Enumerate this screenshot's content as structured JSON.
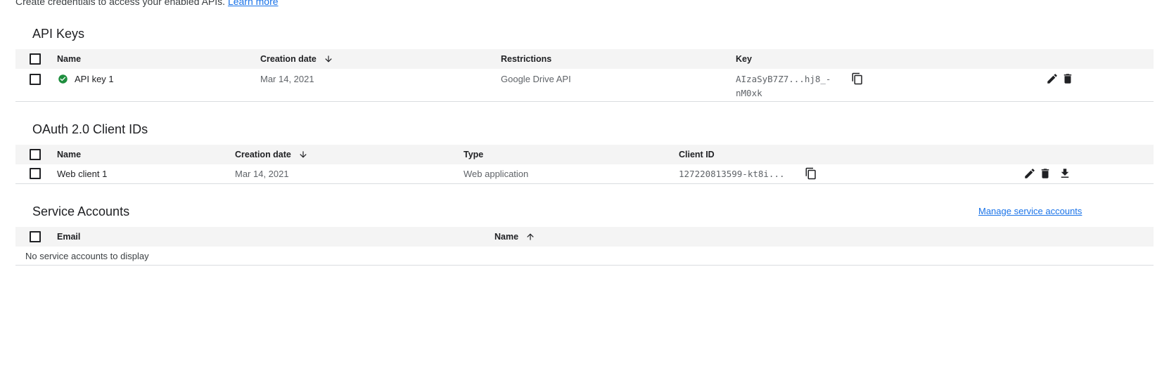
{
  "intro": {
    "text": "Create credentials to access your enabled APIs.",
    "learn_more": "Learn more"
  },
  "api_keys": {
    "title": "API Keys",
    "columns": {
      "name": "Name",
      "creation_date": "Creation date",
      "restrictions": "Restrictions",
      "key": "Key"
    },
    "rows": [
      {
        "name": "API key 1",
        "creation_date": "Mar 14, 2021",
        "restrictions": "Google Drive API",
        "key_line1": "AIzaSyB7Z7...hj8_-",
        "key_line2": "nM0xk"
      }
    ]
  },
  "oauth": {
    "title": "OAuth 2.0 Client IDs",
    "columns": {
      "name": "Name",
      "creation_date": "Creation date",
      "type": "Type",
      "client_id": "Client ID"
    },
    "rows": [
      {
        "name": "Web client 1",
        "creation_date": "Mar 14, 2021",
        "type": "Web application",
        "client_id": "127220813599-kt8i..."
      }
    ]
  },
  "service_accounts": {
    "title": "Service Accounts",
    "manage_link": "Manage service accounts",
    "columns": {
      "email": "Email",
      "name": "Name"
    },
    "empty_text": "No service accounts to display"
  },
  "colors": {
    "accent": "#1a73e8",
    "success": "#1e8e3e",
    "header_bg": "#f4f4f4"
  },
  "icons": {
    "sort_desc": "arrow-down-icon",
    "sort_asc": "arrow-up-icon",
    "status": "check-circle-icon",
    "copy": "copy-icon",
    "edit": "pencil-icon",
    "delete": "trash-icon",
    "download": "download-icon"
  }
}
